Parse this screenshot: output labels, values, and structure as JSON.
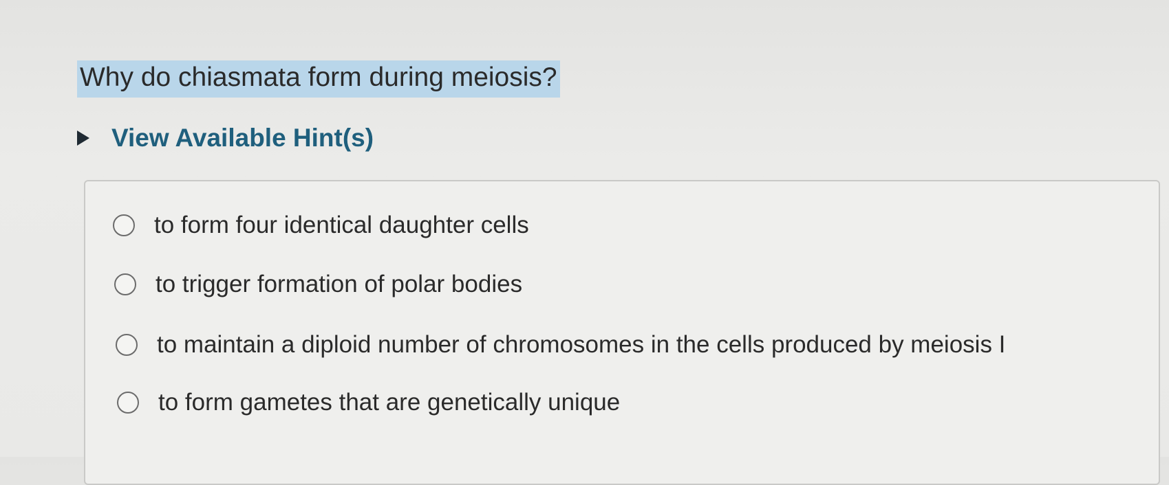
{
  "question": {
    "text": "Why do chiasmata form during meiosis?"
  },
  "hint": {
    "label": "View Available Hint(s)",
    "icon": "triangle-right-icon"
  },
  "options": [
    {
      "label": "to form four identical daughter cells",
      "selected": false
    },
    {
      "label": "to trigger formation of polar bodies",
      "selected": false
    },
    {
      "label": "to maintain a diploid number of chromosomes in the cells produced by meiosis I",
      "selected": false
    },
    {
      "label": "to form gametes that are genetically unique",
      "selected": false
    }
  ],
  "colors": {
    "question_highlight": "#b9d6ea",
    "hint_text": "#1f5f7d",
    "body_text": "#2a2a2a"
  }
}
